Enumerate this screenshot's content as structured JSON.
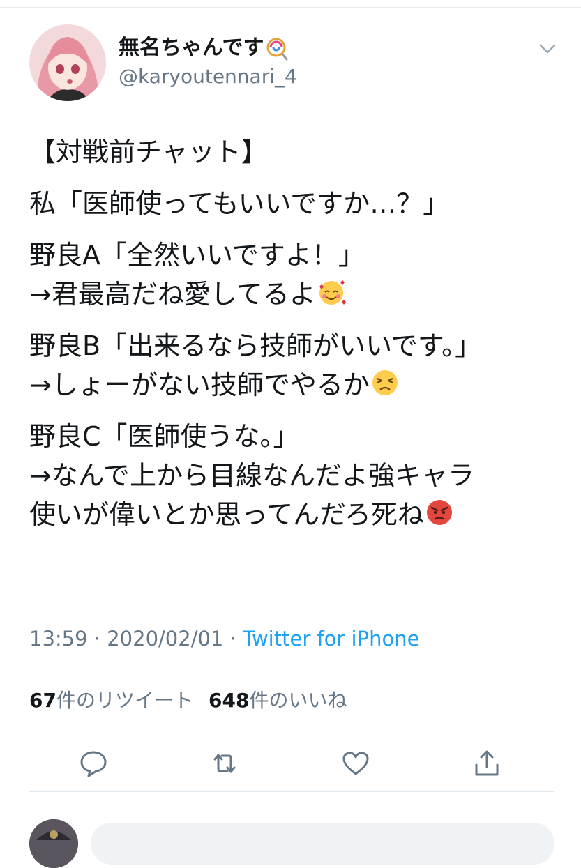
{
  "user": {
    "display_name": "無名ちゃんです",
    "handle": "@karyoutennari_4",
    "name_icon": "lollipop-icon"
  },
  "tweet": {
    "lines": [
      "【対戦前チャット】",
      "私「医師使ってもいいですか…？」",
      "野良A「全然いいですよ！」",
      "→君最高だね愛してるよ",
      "野良B「出来るなら技師がいいです。」",
      "→しょーがない技師でやるか",
      "野良C「医師使うな。」",
      "→なんで上から目線なんだよ強キャラ",
      "使いが偉いとか思ってんだろ死ね"
    ],
    "emojis": [
      "smiling-face-with-hearts-emoji",
      "persevering-face-emoji",
      "angry-face-emoji"
    ]
  },
  "meta": {
    "time": "13:59",
    "separator": " · ",
    "date": "2020/02/01",
    "source": "Twitter for iPhone"
  },
  "stats": {
    "retweet_count": "67",
    "retweet_label": "件のリツイート",
    "like_count": "648",
    "like_label": "件のいいね"
  },
  "actions": [
    "reply-icon",
    "retweet-icon",
    "like-icon",
    "share-icon"
  ],
  "colors": {
    "accent": "#1da1f2",
    "secondary_text": "#657786",
    "divider": "#e1e8ed"
  }
}
